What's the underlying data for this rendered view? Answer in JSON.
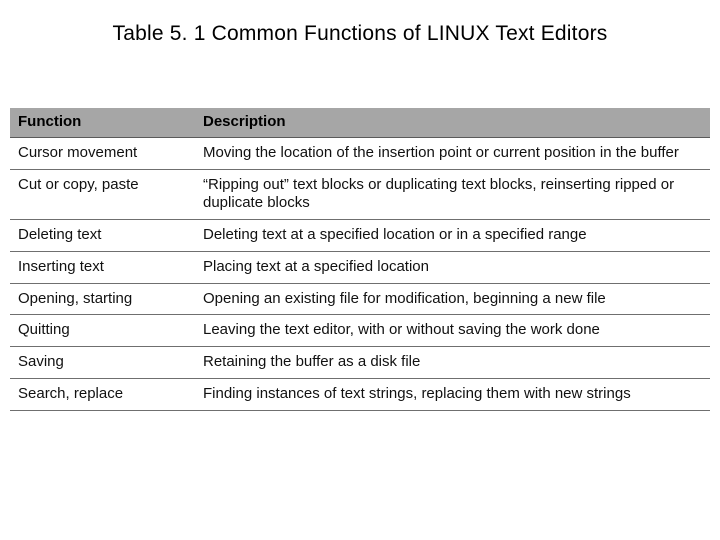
{
  "title": "Table 5. 1  Common Functions of LINUX Text Editors",
  "columns": {
    "c0": "Function",
    "c1": "Description"
  },
  "rows": [
    {
      "function": "Cursor movement",
      "description": "Moving the location of the insertion point or current position in the buffer"
    },
    {
      "function": "Cut or copy, paste",
      "description": "“Ripping out” text blocks or duplicating text blocks, reinserting ripped or duplicate blocks"
    },
    {
      "function": "Deleting text",
      "description": "Deleting text at a specified location or in a specified range"
    },
    {
      "function": "Inserting text",
      "description": "Placing text at a specified location"
    },
    {
      "function": "Opening, starting",
      "description": "Opening an existing file for modification, beginning a new file"
    },
    {
      "function": "Quitting",
      "description": "Leaving the text editor, with or without saving the work done"
    },
    {
      "function": "Saving",
      "description": "Retaining the buffer as a disk file"
    },
    {
      "function": "Search, replace",
      "description": "Finding instances of text strings, replacing them with new strings"
    }
  ],
  "chart_data": {
    "type": "table",
    "title": "Table 5.1 Common Functions of LINUX Text Editors",
    "columns": [
      "Function",
      "Description"
    ],
    "rows": [
      [
        "Cursor movement",
        "Moving the location of the insertion point or current position in the buffer"
      ],
      [
        "Cut or copy, paste",
        "\"Ripping out\" text blocks or duplicating text blocks, reinserting ripped or duplicate blocks"
      ],
      [
        "Deleting text",
        "Deleting text at a specified location or in a specified range"
      ],
      [
        "Inserting text",
        "Placing text at a specified location"
      ],
      [
        "Opening, starting",
        "Opening an existing file for modification, beginning a new file"
      ],
      [
        "Quitting",
        "Leaving the text editor, with or without saving the work done"
      ],
      [
        "Saving",
        "Retaining the buffer as a disk file"
      ],
      [
        "Search, replace",
        "Finding instances of text strings, replacing them with new strings"
      ]
    ]
  }
}
